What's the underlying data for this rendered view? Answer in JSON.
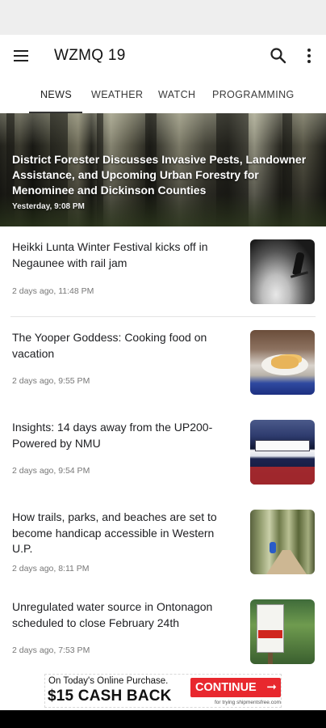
{
  "colors": {
    "statusbar": "#eeeeee",
    "accent": "#333333",
    "ad_button": "#e8282e",
    "navbar": "#000000"
  },
  "appbar": {
    "title": "WZMQ 19",
    "menu_icon": "hamburger-menu-icon",
    "search_icon": "search-icon",
    "more_icon": "more-vert-icon"
  },
  "tabs": [
    {
      "label": "NEWS",
      "active": true
    },
    {
      "label": "WEATHER",
      "active": false
    },
    {
      "label": "WATCH",
      "active": false
    },
    {
      "label": "PROGRAMMING",
      "active": false
    }
  ],
  "hero": {
    "title": "District Forester Discusses Invasive Pests, Landowner Assistance, and Upcoming Urban Forestry for Menominee and Dickinson Counties",
    "time": "Yesterday, 9:08 PM"
  },
  "stories": [
    {
      "headline": "Heikki Lunta Winter Festival kicks off in Negaunee with rail jam",
      "time": "2 days ago, 11:48 PM"
    },
    {
      "headline": "The Yooper Goddess: Cooking food on vacation",
      "time": "2 days ago, 9:55 PM"
    },
    {
      "headline": "Insights: 14 days away from the UP200-Powered by NMU",
      "time": "2 days ago, 9:54 PM"
    },
    {
      "headline": "How trails, parks, and beaches are set to become handicap accessible in Western U.P.",
      "time": "2 days ago, 8:11 PM"
    },
    {
      "headline": "Unregulated water source in Ontonagon scheduled to close February 24th",
      "time": "2 days ago, 7:53 PM"
    }
  ],
  "ad": {
    "line1": "On Today's Online Purchase.",
    "line2": "$15 CASH BACK",
    "button": "CONTINUE",
    "arrow": "➞",
    "small": "for trying shipmentsfree.com"
  }
}
